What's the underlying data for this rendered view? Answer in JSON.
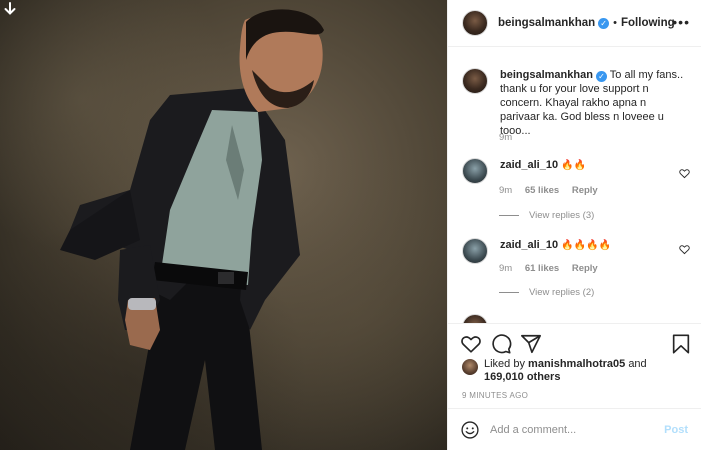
{
  "post": {
    "username": "beingsalmankhan",
    "follow_status": "Following",
    "separator": "•",
    "more_icon": "more-horizontal-icon",
    "verified_icon": "verified-badge-icon"
  },
  "caption": {
    "username": "beingsalmankhan",
    "text": "To all my fans.. thank u for your love support n concern. Khayal rakho apna n parivaar ka. God bless n loveee u tooo...",
    "time": "9m"
  },
  "comments": [
    {
      "username": "zaid_ali_10",
      "text": "🔥🔥",
      "time": "9m",
      "likes": "65 likes",
      "reply": "Reply",
      "view_replies": "View replies (3)"
    },
    {
      "username": "zaid_ali_10",
      "text": "🔥🔥🔥🔥",
      "time": "9m",
      "likes": "61 likes",
      "reply": "Reply",
      "view_replies": "View replies (2)"
    }
  ],
  "actions": {
    "like_icon": "heart-icon",
    "comment_icon": "comment-icon",
    "share_icon": "share-icon",
    "save_icon": "bookmark-icon"
  },
  "likes": {
    "prefix": "Liked by",
    "user": "manishmalhotra05",
    "and": "and",
    "count": "169,010 others"
  },
  "timestamp": "9 MINUTES AGO",
  "add_comment": {
    "placeholder": "Add a comment...",
    "post_label": "Post"
  },
  "colors": {
    "accent": "#3897f0",
    "muted": "#8e8e8e",
    "post_disabled": "#b2dffc"
  }
}
